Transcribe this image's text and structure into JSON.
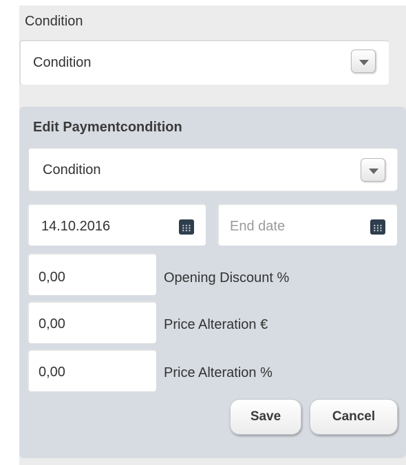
{
  "condition_section": {
    "label": "Condition",
    "select_value": "Condition"
  },
  "edit_panel": {
    "title": "Edit Paymentcondition",
    "condition_select_value": "Condition",
    "start_date": {
      "value": "14.10.2016"
    },
    "end_date": {
      "value": "",
      "placeholder": "End date"
    },
    "opening_discount": {
      "value": "0,00",
      "label": "Opening Discount %"
    },
    "price_alteration_eur": {
      "value": "0,00",
      "label": "Price Alteration €"
    },
    "price_alteration_pct": {
      "value": "0,00",
      "label": "Price Alteration %"
    },
    "save_label": "Save",
    "cancel_label": "Cancel"
  },
  "icons": {
    "dropdown": "chevron-down-icon",
    "calendar": "calendar-icon"
  }
}
